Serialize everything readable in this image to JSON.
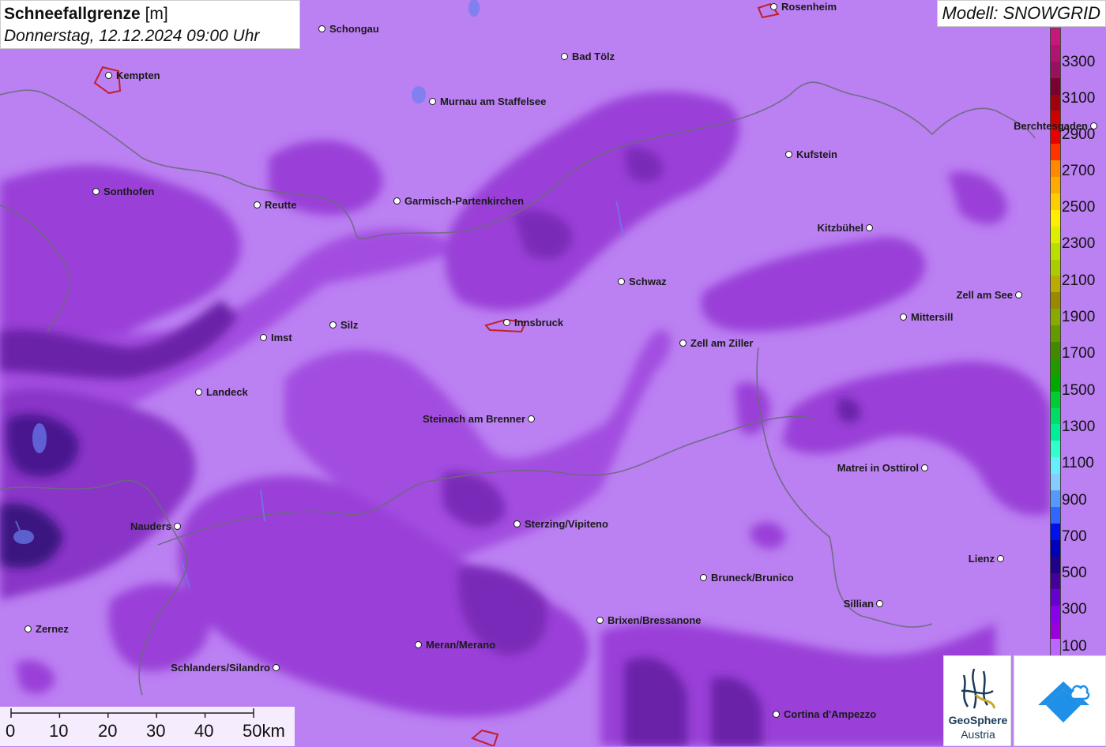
{
  "header": {
    "title_bold": "Schneefallgrenze",
    "title_unit": " [m]",
    "subtitle": "Donnerstag, 12.12.2024 09:00 Uhr"
  },
  "model": {
    "label": "Modell: SNOWGRID"
  },
  "legend": {
    "labels": [
      "3300",
      "3100",
      "2900",
      "2700",
      "2500",
      "2300",
      "2100",
      "1900",
      "1700",
      "1500",
      "1300",
      "1100",
      "900",
      "700",
      "500",
      "300",
      "100"
    ],
    "colors": [
      "#c8177a",
      "#b01470",
      "#9a1060",
      "#7a0030",
      "#a00010",
      "#cc0000",
      "#e60000",
      "#ff3300",
      "#ff8800",
      "#ffaa00",
      "#ffcc00",
      "#ffee00",
      "#ddee00",
      "#bbdd00",
      "#aacc00",
      "#bbaa00",
      "#998800",
      "#88aa00",
      "#669900",
      "#448800",
      "#229900",
      "#00aa00",
      "#00cc33",
      "#00dd66",
      "#00ee99",
      "#33ffcc",
      "#66eeff",
      "#88ccff",
      "#5599ff",
      "#3366ff",
      "#0011ee",
      "#0000bb",
      "#220088",
      "#440099",
      "#6600cc",
      "#8800ee",
      "#9900dd",
      "#bb66ff"
    ]
  },
  "cities": [
    {
      "name": "Rosenheim",
      "dot": "left"
    },
    {
      "name": "Schongau",
      "dot": "left"
    },
    {
      "name": "Kempten",
      "dot": "left"
    },
    {
      "name": "Bad Tölz",
      "dot": "left"
    },
    {
      "name": "Murnau am Staffelsee",
      "dot": "left"
    },
    {
      "name": "Berchtesgaden",
      "dot": "right"
    },
    {
      "name": "Kufstein",
      "dot": "left"
    },
    {
      "name": "Sonthofen",
      "dot": "left"
    },
    {
      "name": "Reutte",
      "dot": "left"
    },
    {
      "name": "Garmisch-Partenkirchen",
      "dot": "left"
    },
    {
      "name": "Kitzbühel",
      "dot": "right"
    },
    {
      "name": "Schwaz",
      "dot": "left"
    },
    {
      "name": "Zell am See",
      "dot": "right"
    },
    {
      "name": "Mittersill",
      "dot": "left"
    },
    {
      "name": "Innsbruck",
      "dot": "left"
    },
    {
      "name": "Silz",
      "dot": "left"
    },
    {
      "name": "Imst",
      "dot": "left"
    },
    {
      "name": "Zell am Ziller",
      "dot": "left"
    },
    {
      "name": "Landeck",
      "dot": "left"
    },
    {
      "name": "Steinach am Brenner",
      "dot": "right"
    },
    {
      "name": "Matrei in Osttirol",
      "dot": "right"
    },
    {
      "name": "Nauders",
      "dot": "right"
    },
    {
      "name": "Sterzing/Vipiteno",
      "dot": "left"
    },
    {
      "name": "Lienz",
      "dot": "right"
    },
    {
      "name": "Bruneck/Brunico",
      "dot": "left"
    },
    {
      "name": "Sillian",
      "dot": "right"
    },
    {
      "name": "Brixen/Bressanone",
      "dot": "left"
    },
    {
      "name": "Zernez",
      "dot": "left"
    },
    {
      "name": "Meran/Merano",
      "dot": "left"
    },
    {
      "name": "Schlanders/Silandro",
      "dot": "right"
    },
    {
      "name": "Cortina d'Ampezzo",
      "dot": "left"
    }
  ],
  "scale": {
    "labels": [
      "0",
      "10",
      "20",
      "30",
      "40",
      "50km"
    ]
  },
  "logos": {
    "geosphere_line1": "GeoSphere",
    "geosphere_line2": "Austria"
  }
}
